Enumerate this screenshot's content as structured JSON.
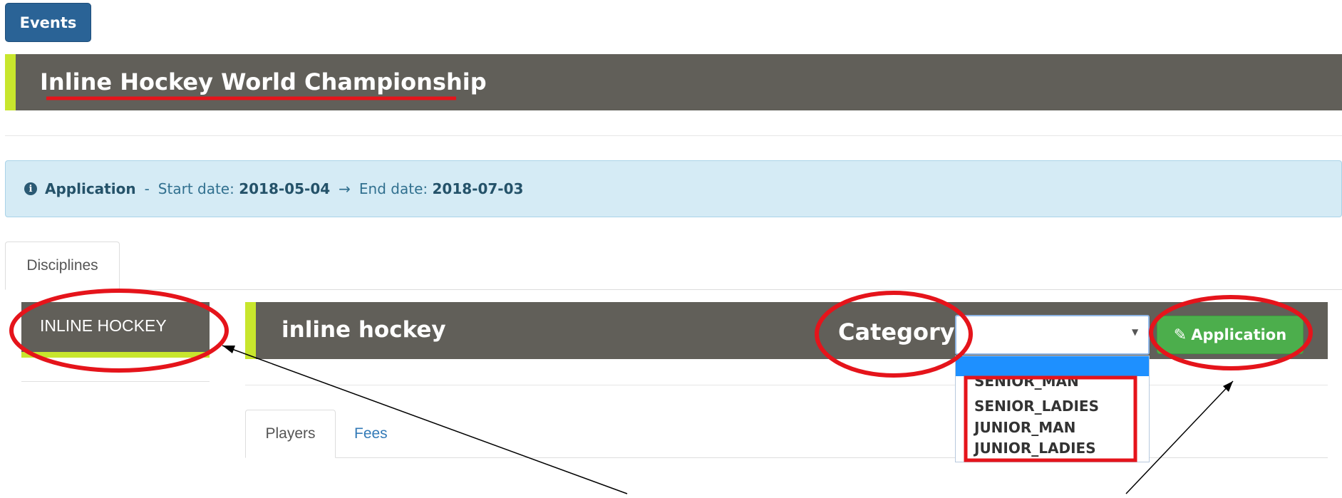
{
  "events_button": "Events",
  "event": {
    "title": "Inline Hockey World Championship"
  },
  "info": {
    "label": "Application",
    "separator": "-",
    "start_label": "Start date:",
    "start_date": "2018-05-04",
    "arrow": "→",
    "end_label": "End date:",
    "end_date": "2018-07-03"
  },
  "tabs": {
    "disciplines": "Disciplines"
  },
  "sidebar": {
    "items": [
      {
        "label": "INLINE HOCKEY",
        "active": true
      }
    ]
  },
  "discipline": {
    "title": "inline hockey",
    "category_label": "Category",
    "category_value": "",
    "category_options": [
      "SENIOR_MAN",
      "SENIOR_LADIES",
      "JUNIOR_MAN",
      "JUNIOR_LADIES"
    ],
    "application_button": "Application"
  },
  "subtabs": {
    "players": "Players",
    "fees": "Fees"
  },
  "icons": {
    "info": "info-circle-icon",
    "edit": "edit-icon",
    "caret": "caret-down-icon"
  },
  "colors": {
    "header_bg": "#615f59",
    "accent": "#c8e62d",
    "primary": "#2a6396",
    "success": "#4cae4c",
    "info_bg": "#d5ebf5",
    "annotation": "#e5141b"
  }
}
